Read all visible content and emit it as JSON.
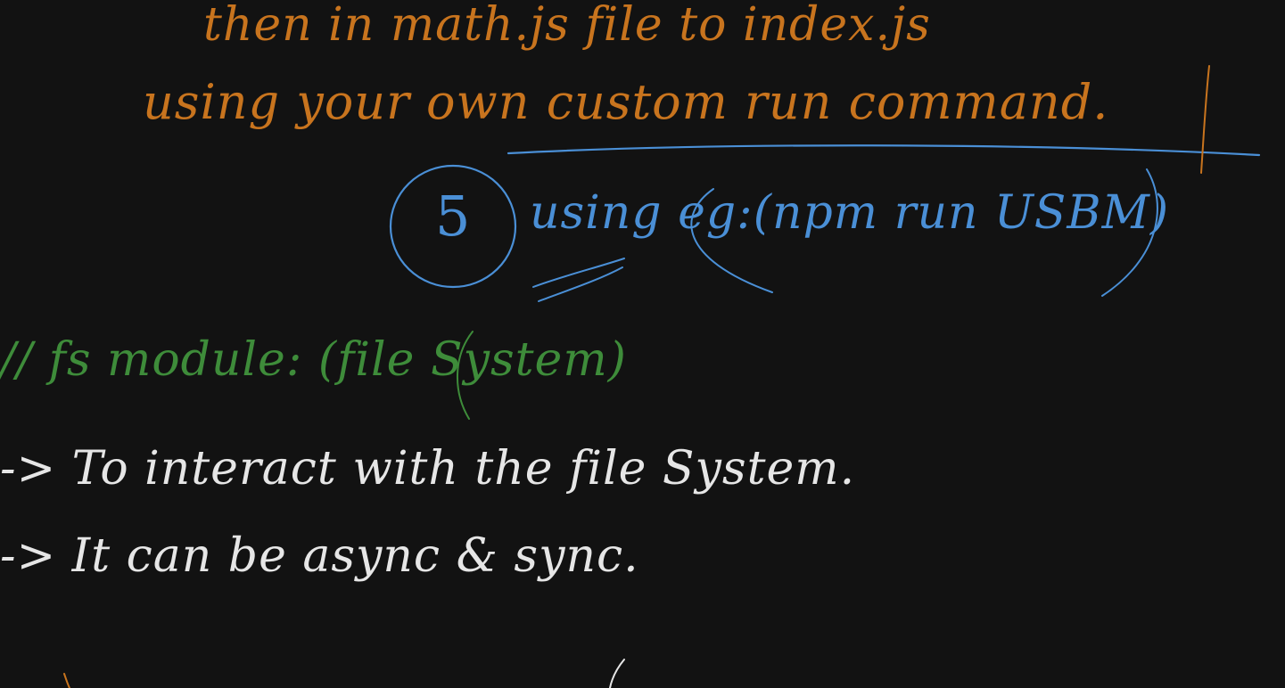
{
  "colors": {
    "background": "#121212",
    "orange": "#c8741e",
    "blue": "#4a8fd6",
    "green": "#3e8c3a",
    "white": "#e6e6e6"
  },
  "notes": {
    "line1": "then in math.js file to index.js",
    "line2": "using your own custom run command.",
    "line3_number": "5",
    "line3": "using eg:(npm run USBM)",
    "line4": "// fs module: (file System)",
    "line5": "-> To interact with the file System.",
    "line6": "-> It can be async & sync."
  }
}
